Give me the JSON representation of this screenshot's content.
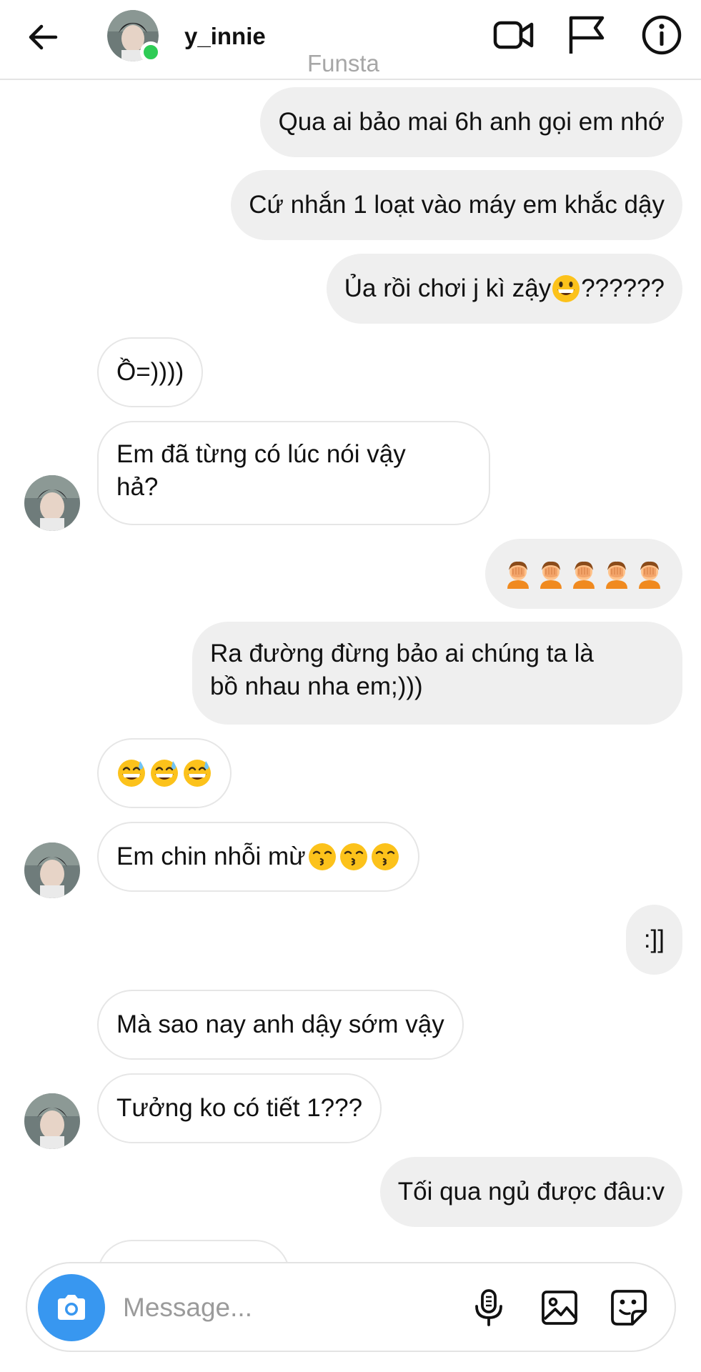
{
  "header": {
    "username": "y_innie",
    "subtitle": "Funsta",
    "online_color": "#2ecc55"
  },
  "icons": {
    "back": "arrow-left-icon",
    "video": "video-camera-icon",
    "flag": "flag-icon",
    "info": "info-icon",
    "camera": "camera-icon",
    "mic": "microphone-icon",
    "gallery": "gallery-icon",
    "sticker": "sticker-icon"
  },
  "messages": [
    {
      "sender": "me",
      "text": "Qua ai bảo mai 6h anh gọi em nhớ"
    },
    {
      "sender": "me",
      "text": "Cứ nhắn 1 loạt vào máy em khắc dậy"
    },
    {
      "sender": "me",
      "text": "Ủa rồi chơi j kì zậy",
      "suffix": "??????",
      "emoji": [
        "grinning-face"
      ]
    },
    {
      "sender": "them",
      "text": "Ồ=))))"
    },
    {
      "sender": "them",
      "line1": "Em đã từng có lúc nói vậy",
      "line2": "hả?"
    },
    {
      "sender": "me",
      "emoji": [
        "person-facepalming",
        "person-facepalming",
        "person-facepalming",
        "person-facepalming",
        "person-facepalming"
      ]
    },
    {
      "sender": "me",
      "line1": "Ra đường đừng bảo ai chúng ta là",
      "line2": "bồ nhau nha em;)))"
    },
    {
      "sender": "them",
      "emoji": [
        "grinning-face-with-sweat",
        "grinning-face-with-sweat",
        "grinning-face-with-sweat"
      ]
    },
    {
      "sender": "them",
      "text": "Em chin nhỗi mừ",
      "emoji": [
        "kissing-face",
        "kissing-face",
        "kissing-face"
      ]
    },
    {
      "sender": "me",
      "text": ":]]"
    },
    {
      "sender": "them",
      "text": "Mà sao nay anh dậy sớm vậy"
    },
    {
      "sender": "them",
      "text": "Tưởng ko có tiết 1???"
    },
    {
      "sender": "me",
      "text": "Tối qua ngủ được đâu:v"
    }
  ],
  "composer": {
    "placeholder": "Message..."
  },
  "colors": {
    "outgoing_bubble": "#efefef",
    "incoming_border": "#e6e6e6",
    "camera_button": "#3897f0"
  }
}
